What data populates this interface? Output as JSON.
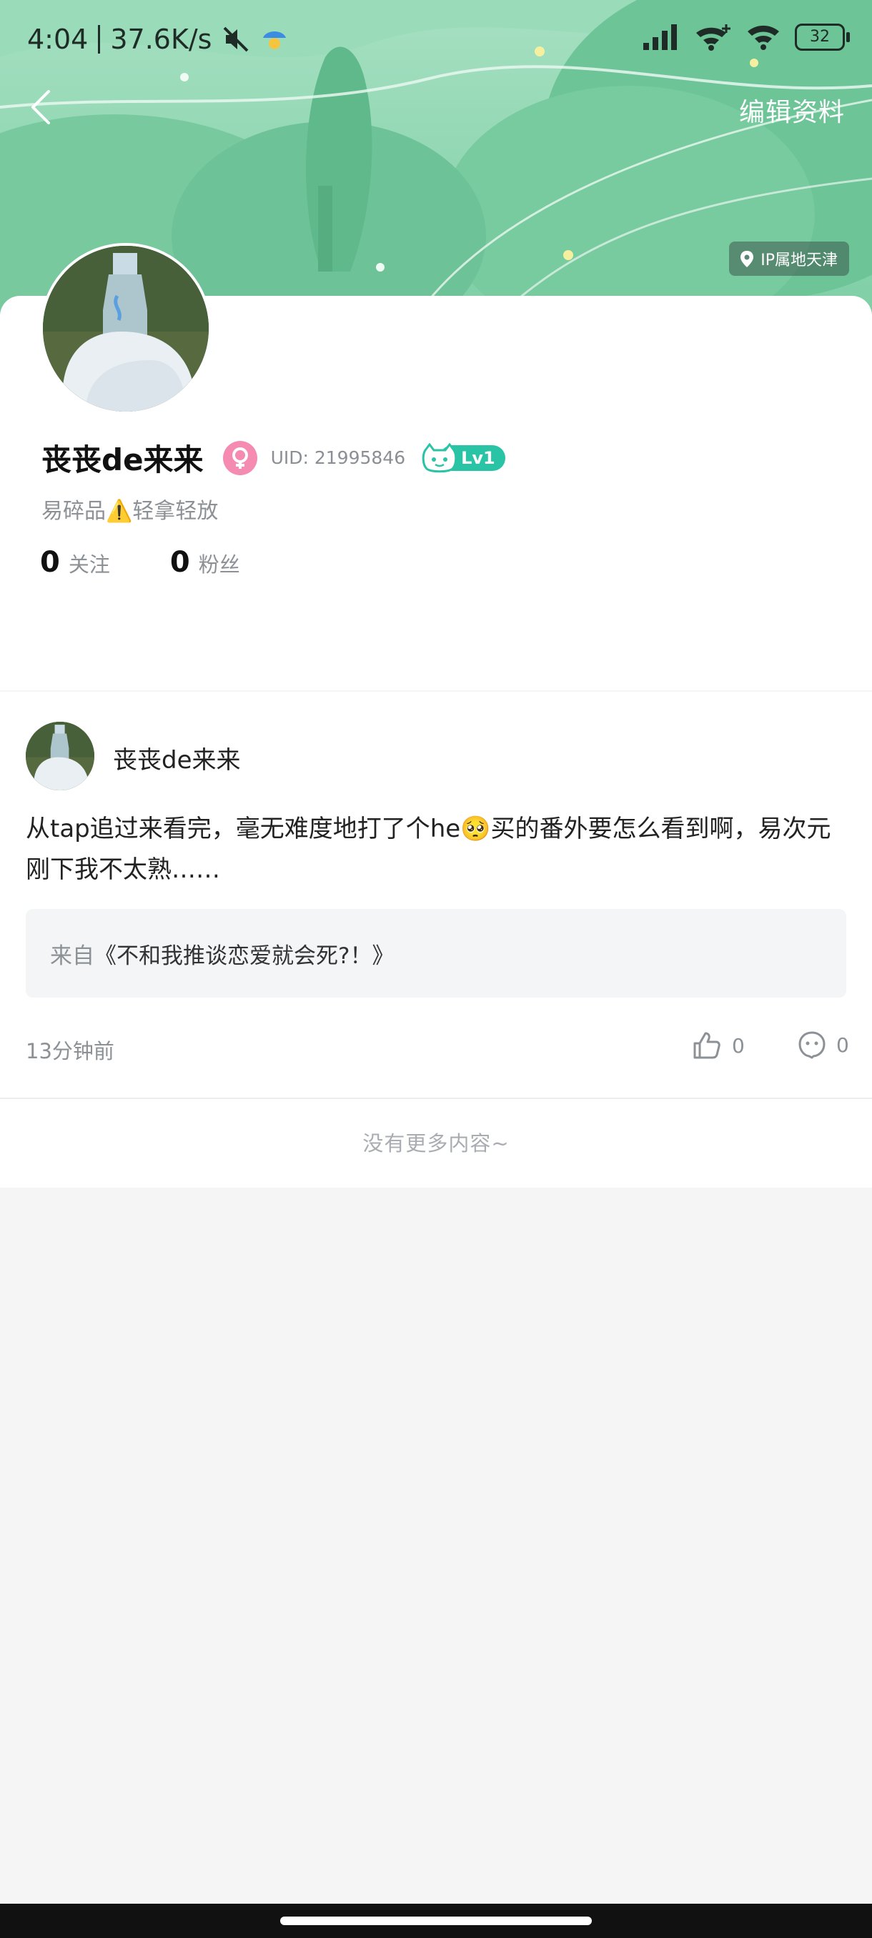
{
  "status_bar": {
    "time": "4:04",
    "net_speed": "37.6K/s",
    "battery": "32"
  },
  "header": {
    "edit_label": "编辑资料",
    "ip_location": "IP属地天津"
  },
  "profile": {
    "name": "丧丧de来来",
    "uid": "UID: 21995846",
    "level": "Lv1",
    "bio": "易碎品⚠️轻拿轻放",
    "following_count": "0",
    "following_label": "关注",
    "followers_count": "0",
    "followers_label": "粉丝"
  },
  "post": {
    "author": "丧丧de来来",
    "text": "从tap追过来看完，毫无难度地打了个he🥺买的番外要怎么看到啊，易次元刚下我不太熟……",
    "source_prefix": "来自",
    "source_title": "《不和我推谈恋爱就会死?！》",
    "time": "13分钟前",
    "likes": "0",
    "comments": "0"
  },
  "feed": {
    "end_text": "没有更多内容~"
  },
  "colors": {
    "banner_green": "#7fcfa6",
    "level_teal": "#29c3a5",
    "gender_pink": "#f58bb0"
  }
}
